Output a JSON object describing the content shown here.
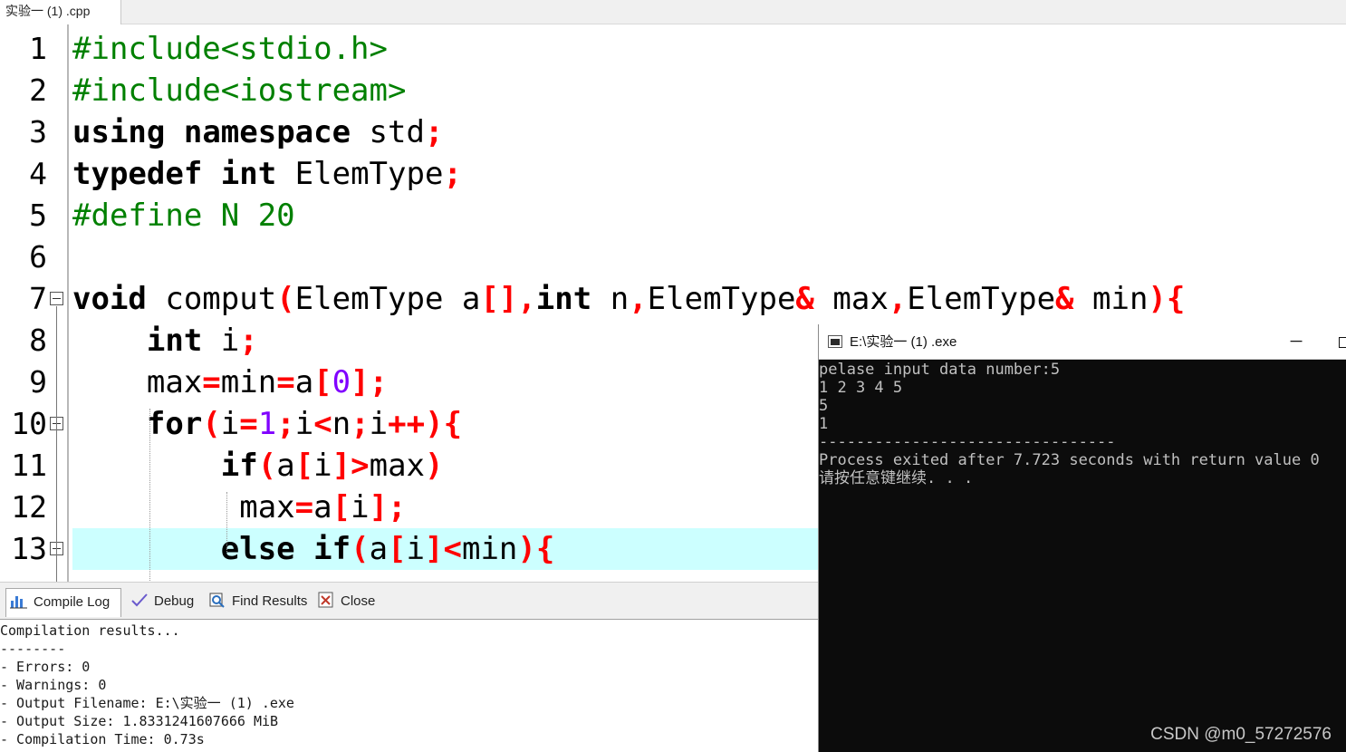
{
  "tab": {
    "title": "实验一 (1) .cpp"
  },
  "editor": {
    "lines": [
      {
        "num": "1",
        "tokens": [
          {
            "t": "#include<stdio.h>",
            "c": "pre"
          }
        ]
      },
      {
        "num": "2",
        "tokens": [
          {
            "t": "#include<iostream>",
            "c": "pre"
          }
        ]
      },
      {
        "num": "3",
        "tokens": [
          {
            "t": "using",
            "c": "kw"
          },
          {
            "t": " ",
            "c": "id"
          },
          {
            "t": "namespace",
            "c": "kw"
          },
          {
            "t": " std",
            "c": "id"
          },
          {
            "t": ";",
            "c": "sym"
          }
        ]
      },
      {
        "num": "4",
        "tokens": [
          {
            "t": "typedef",
            "c": "kw"
          },
          {
            "t": " ",
            "c": "id"
          },
          {
            "t": "int",
            "c": "kw"
          },
          {
            "t": " ElemType",
            "c": "id"
          },
          {
            "t": ";",
            "c": "sym"
          }
        ]
      },
      {
        "num": "5",
        "tokens": [
          {
            "t": "#define N 20",
            "c": "pre"
          }
        ]
      },
      {
        "num": "6",
        "tokens": []
      },
      {
        "num": "7",
        "tokens": [
          {
            "t": "void",
            "c": "kw"
          },
          {
            "t": " comput",
            "c": "id"
          },
          {
            "t": "(",
            "c": "sym"
          },
          {
            "t": "ElemType a",
            "c": "id"
          },
          {
            "t": "[],",
            "c": "sym"
          },
          {
            "t": "int",
            "c": "kw"
          },
          {
            "t": " n",
            "c": "id"
          },
          {
            "t": ",",
            "c": "sym"
          },
          {
            "t": "ElemType",
            "c": "id"
          },
          {
            "t": "&",
            "c": "sym"
          },
          {
            "t": " max",
            "c": "id"
          },
          {
            "t": ",",
            "c": "sym"
          },
          {
            "t": "ElemType",
            "c": "id"
          },
          {
            "t": "&",
            "c": "sym"
          },
          {
            "t": " min",
            "c": "id"
          },
          {
            "t": "){",
            "c": "sym"
          }
        ]
      },
      {
        "num": "8",
        "tokens": [
          {
            "t": "    ",
            "c": "id"
          },
          {
            "t": "int",
            "c": "kw"
          },
          {
            "t": " i",
            "c": "id"
          },
          {
            "t": ";",
            "c": "sym"
          }
        ]
      },
      {
        "num": "9",
        "tokens": [
          {
            "t": "    max",
            "c": "id"
          },
          {
            "t": "=",
            "c": "sym"
          },
          {
            "t": "min",
            "c": "id"
          },
          {
            "t": "=",
            "c": "sym"
          },
          {
            "t": "a",
            "c": "id"
          },
          {
            "t": "[",
            "c": "sym"
          },
          {
            "t": "0",
            "c": "num"
          },
          {
            "t": "];",
            "c": "sym"
          }
        ]
      },
      {
        "num": "10",
        "tokens": [
          {
            "t": "    ",
            "c": "id"
          },
          {
            "t": "for",
            "c": "kw"
          },
          {
            "t": "(",
            "c": "sym"
          },
          {
            "t": "i",
            "c": "id"
          },
          {
            "t": "=",
            "c": "sym"
          },
          {
            "t": "1",
            "c": "num"
          },
          {
            "t": ";",
            "c": "sym"
          },
          {
            "t": "i",
            "c": "id"
          },
          {
            "t": "<",
            "c": "sym"
          },
          {
            "t": "n",
            "c": "id"
          },
          {
            "t": ";",
            "c": "sym"
          },
          {
            "t": "i",
            "c": "id"
          },
          {
            "t": "++){",
            "c": "sym"
          }
        ]
      },
      {
        "num": "11",
        "tokens": [
          {
            "t": "        ",
            "c": "id"
          },
          {
            "t": "if",
            "c": "kw"
          },
          {
            "t": "(",
            "c": "sym"
          },
          {
            "t": "a",
            "c": "id"
          },
          {
            "t": "[",
            "c": "sym"
          },
          {
            "t": "i",
            "c": "id"
          },
          {
            "t": "]>",
            "c": "sym"
          },
          {
            "t": "max",
            "c": "id"
          },
          {
            "t": ")",
            "c": "sym"
          }
        ]
      },
      {
        "num": "12",
        "tokens": [
          {
            "t": "         max",
            "c": "id"
          },
          {
            "t": "=",
            "c": "sym"
          },
          {
            "t": "a",
            "c": "id"
          },
          {
            "t": "[",
            "c": "sym"
          },
          {
            "t": "i",
            "c": "id"
          },
          {
            "t": "];",
            "c": "sym"
          }
        ]
      },
      {
        "num": "13",
        "tokens": [
          {
            "t": "        ",
            "c": "id"
          },
          {
            "t": "else",
            "c": "kw"
          },
          {
            "t": " ",
            "c": "id"
          },
          {
            "t": "if",
            "c": "kw"
          },
          {
            "t": "(",
            "c": "sym"
          },
          {
            "t": "a",
            "c": "id"
          },
          {
            "t": "[",
            "c": "sym"
          },
          {
            "t": "i",
            "c": "id"
          },
          {
            "t": "]<",
            "c": "sym"
          },
          {
            "t": "min",
            "c": "id"
          },
          {
            "t": "){",
            "c": "sym"
          }
        ]
      }
    ]
  },
  "panel": {
    "tabs": [
      "Compile Log",
      "Debug",
      "Find Results",
      "Close"
    ],
    "log": [
      "Compilation results...",
      "--------",
      "- Errors: 0",
      "- Warnings: 0",
      "- Output Filename: E:\\实验一 (1) .exe",
      "- Output Size: 1.8331241607666 MiB",
      "- Compilation Time: 0.73s"
    ]
  },
  "console": {
    "title": "E:\\实验一 (1) .exe",
    "minimize": "─",
    "lines": [
      "pelase input data number:5",
      "1 2 3 4 5",
      "5",
      "1",
      "--------------------------------",
      "Process exited after 7.723 seconds with return value 0",
      "请按任意键继续. . ."
    ]
  },
  "watermark": "CSDN @m0_57272576"
}
